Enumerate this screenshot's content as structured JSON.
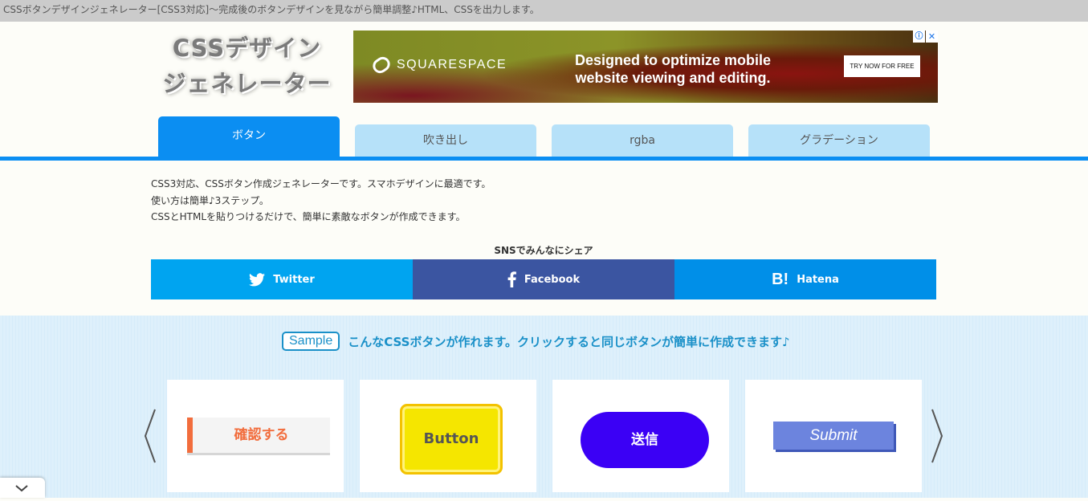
{
  "browser": {
    "title_bar": "CSSボタンデザインジェネレーター[CSS3対応]〜完成後のボタンデザインを見ながら簡単調整♪HTML、CSSを出力します。"
  },
  "header": {
    "logo_line1": "CSSデザイン",
    "logo_line2": "ジェネレーター"
  },
  "ad": {
    "brand": "SQUARESPACE",
    "headline_line1": "Designed to optimize mobile",
    "headline_line2": "website viewing and editing.",
    "cta": "TRY NOW FOR FREE",
    "info_icon": "ⓘ",
    "close_icon": "✕"
  },
  "tabs": [
    {
      "label": "ボタン",
      "active": true
    },
    {
      "label": "吹き出し",
      "active": false
    },
    {
      "label": "rgba",
      "active": false
    },
    {
      "label": "グラデーション",
      "active": false
    }
  ],
  "intro": {
    "line1": "CSS3対応、CSSボタン作成ジェネレーターです。スマホデザインに最適です。",
    "line2": "使い方は簡単♪3ステップ。",
    "line3": "CSSとHTMLを貼りつけるだけで、簡単に素敵なボタンが作成できます。"
  },
  "share": {
    "title": "SNSでみんなにシェア",
    "twitter": {
      "label": "Twitter",
      "color": "#00a4f0",
      "icon": "twitter-icon"
    },
    "facebook": {
      "label": "Facebook",
      "color": "#3b55a1",
      "icon": "facebook-icon"
    },
    "hatena": {
      "label": "Hatena",
      "color": "#008fe8",
      "icon": "hatena-icon"
    }
  },
  "samples": {
    "badge": "Sample",
    "heading": "こんなCSSボタンが作れます。クリックすると同じボタンが簡単に作成できます♪",
    "buttons": [
      {
        "label": "確認する"
      },
      {
        "label": "Button"
      },
      {
        "label": "送信"
      },
      {
        "label": "Submit"
      }
    ],
    "prev_icon": "chevron-left-icon",
    "next_icon": "chevron-right-icon"
  },
  "colors": {
    "accent": "#0b8ef2",
    "tab_inactive": "#b6e1f9",
    "sample_text": "#1a90c8"
  }
}
